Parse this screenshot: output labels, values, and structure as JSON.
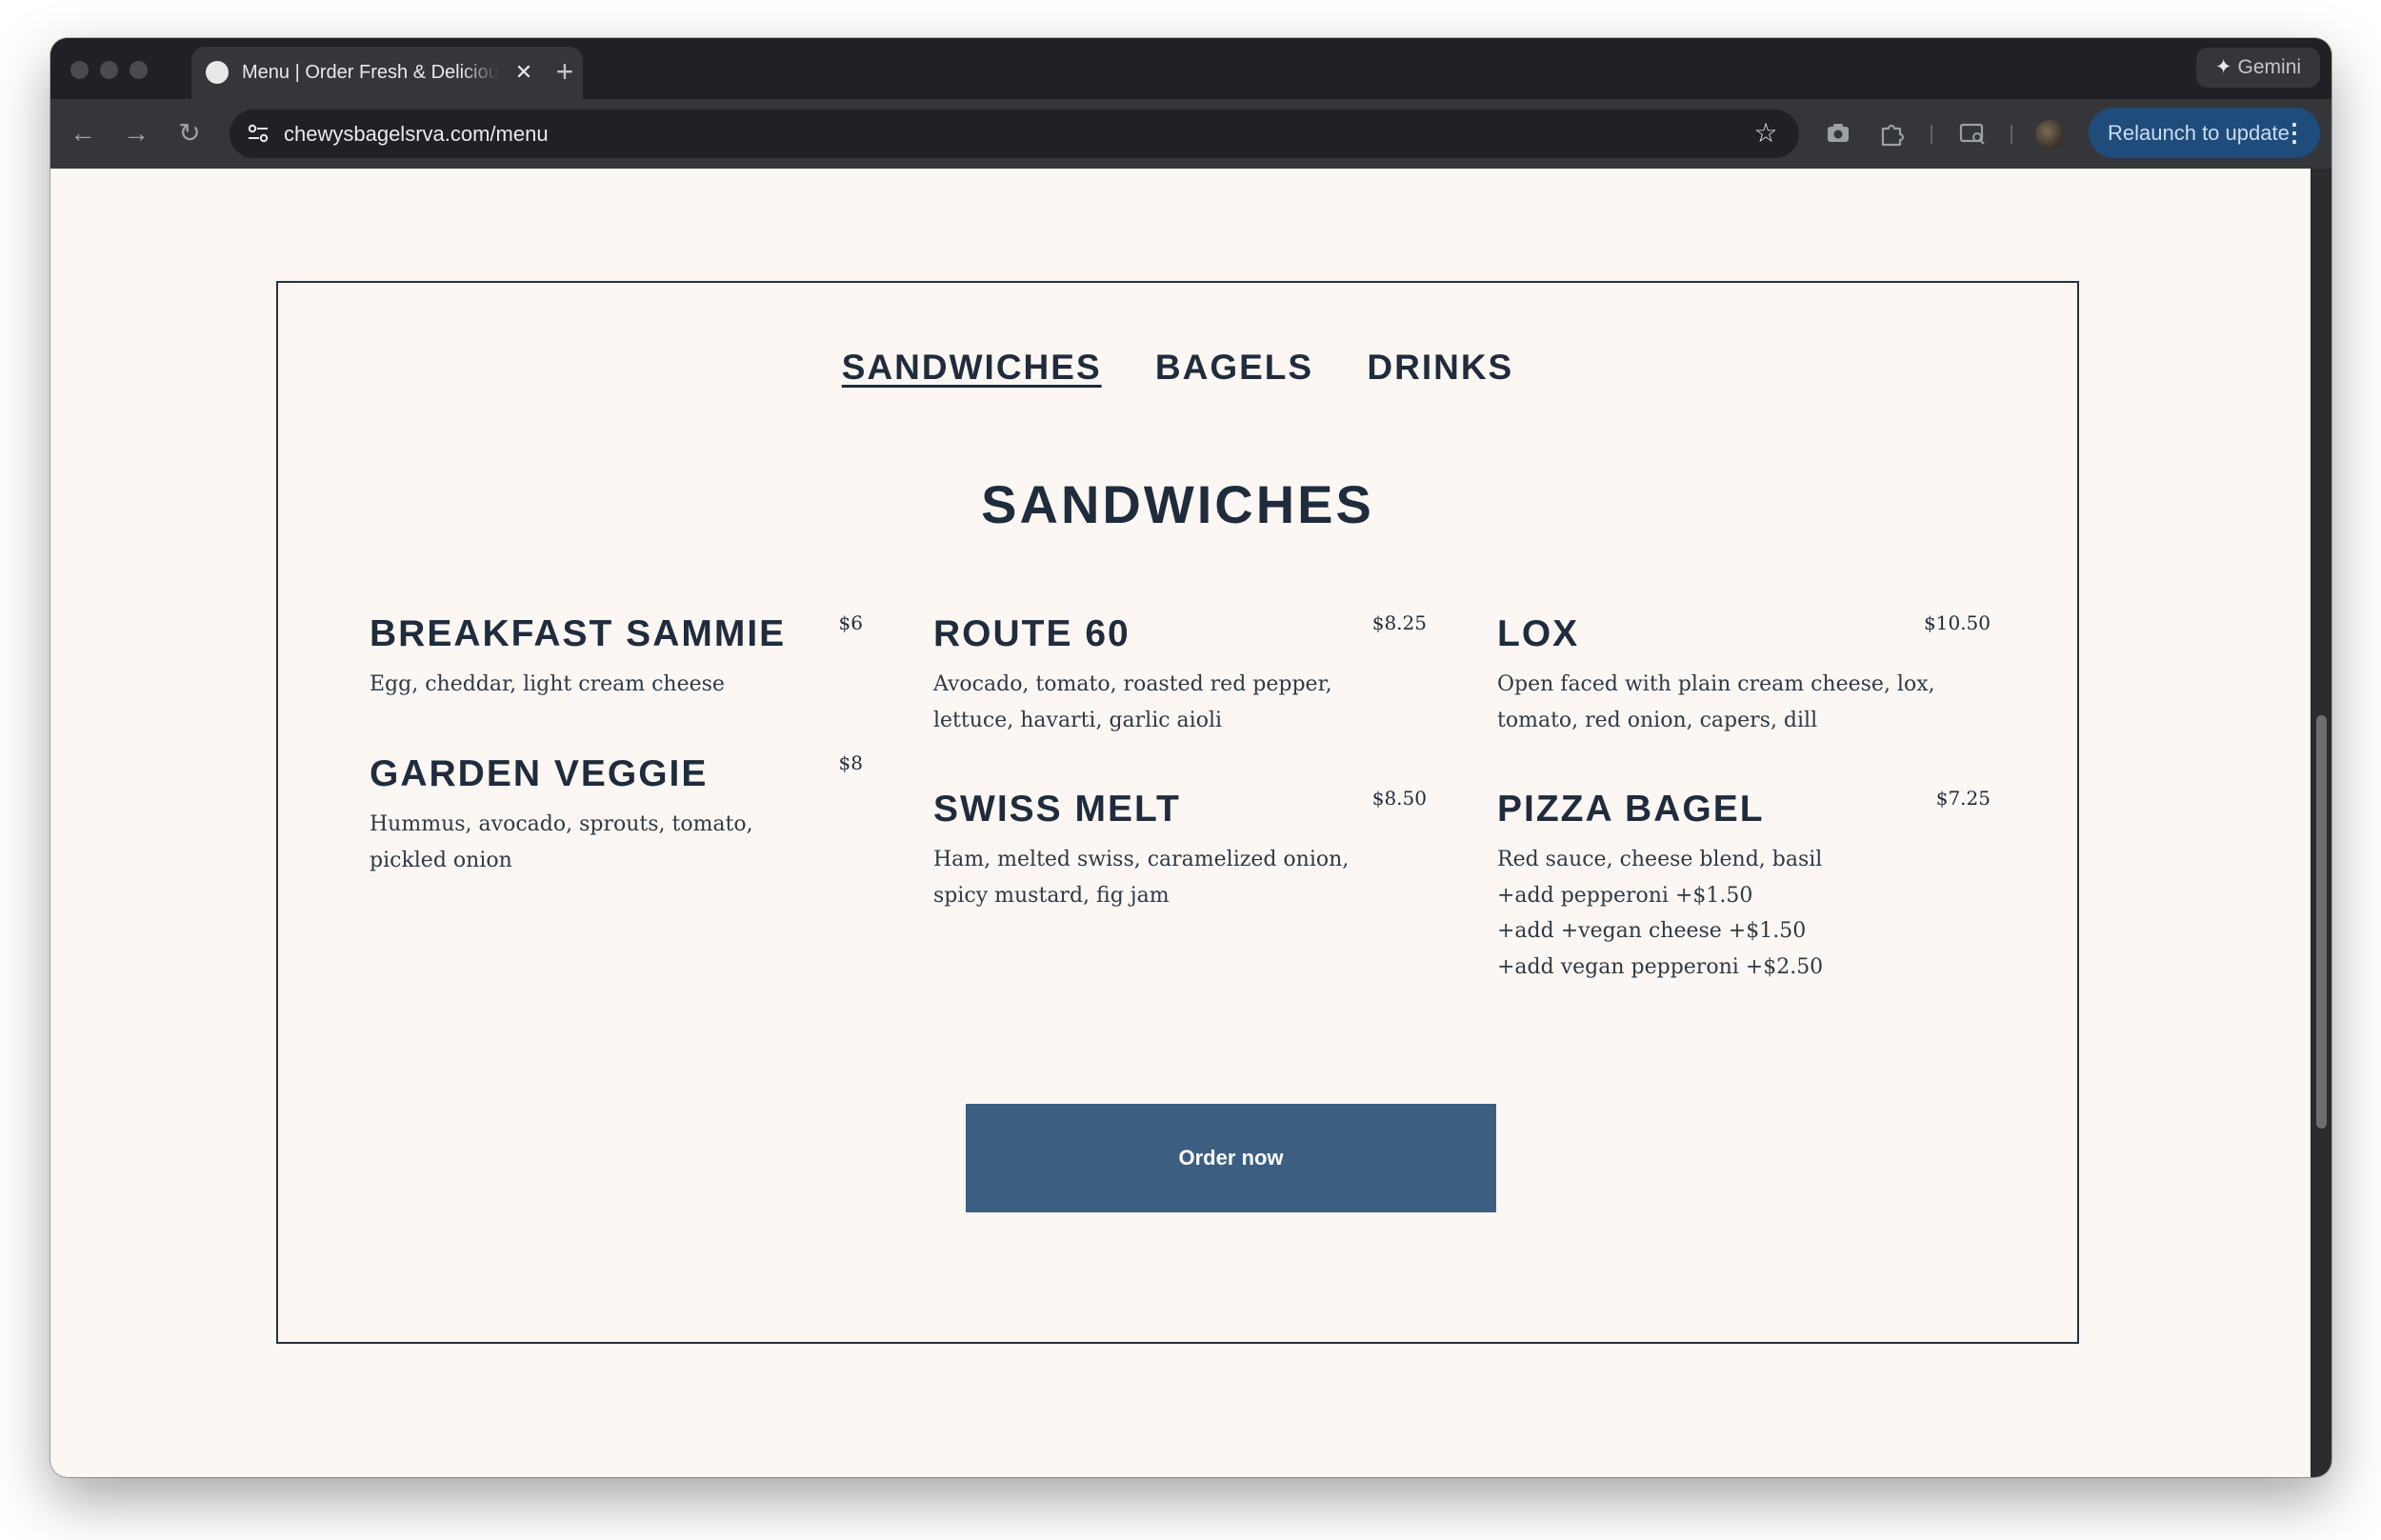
{
  "browser": {
    "tab_title": "Menu | Order Fresh & Delicious",
    "tab_close": "✕",
    "new_tab": "+",
    "gemini_label": "Gemini",
    "gemini_icon": "✦",
    "url": "chewysbagelsrva.com/menu",
    "relaunch_label": "Relaunch to update",
    "menu_dots": "⋮",
    "back_icon": "←",
    "forward_icon": "→",
    "reload_icon": "↻",
    "bookmark_icon": "☆"
  },
  "menu": {
    "tabs": [
      "SANDWICHES",
      "BAGELS",
      "DRINKS"
    ],
    "active_tab": "SANDWICHES",
    "section_title": "SANDWICHES",
    "items": [
      {
        "name": "BREAKFAST SAMMIE",
        "price": "$6",
        "desc": [
          "Egg, cheddar, light cream cheese"
        ]
      },
      {
        "name": "GARDEN VEGGIE",
        "price": "$8",
        "desc": [
          "Hummus, avocado, sprouts, tomato,",
          "pickled onion"
        ]
      },
      {
        "name": "ROUTE 60",
        "price": "$8.25",
        "desc": [
          "Avocado, tomato, roasted red pepper,",
          "lettuce, havarti, garlic aioli"
        ]
      },
      {
        "name": "SWISS MELT",
        "price": "$8.50",
        "desc": [
          "Ham, melted swiss, caramelized onion,",
          "spicy mustard, fig jam"
        ]
      },
      {
        "name": "LOX",
        "price": "$10.50",
        "desc": [
          "Open faced with plain cream cheese, lox,",
          "tomato, red onion, capers, dill"
        ]
      },
      {
        "name": "PIZZA BAGEL",
        "price": "$7.25",
        "desc": [
          "Red sauce, cheese blend, basil",
          "+add pepperoni +$1.50",
          "+add +vegan cheese +$1.50",
          "+add vegan pepperoni +$2.50"
        ]
      }
    ],
    "order_button": "Order now"
  },
  "colors": {
    "page_bg": "#fcf7f3",
    "ink": "#1f2c3d",
    "button": "#3c5f81",
    "relaunch_bg": "#1f4c7b"
  }
}
